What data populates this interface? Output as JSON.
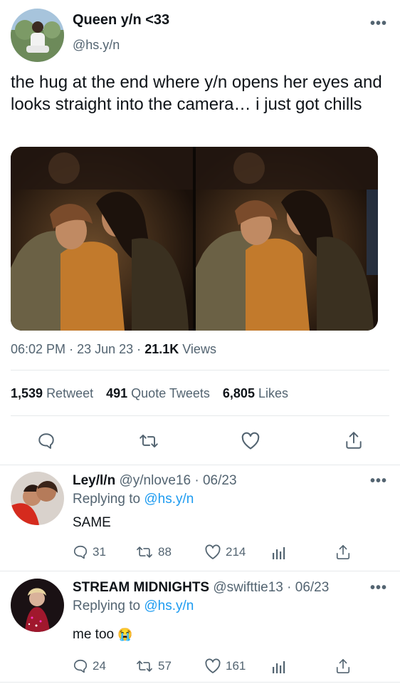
{
  "tweet": {
    "display_name": "Queen y/n <33",
    "handle": "@hs.y/n",
    "text": "the hug at the end where y/n opens her eyes and looks straight into the camera… i just got chills",
    "time": "06:02 PM",
    "sep1": "·",
    "date": "23 Jun 23",
    "sep2": "·",
    "views_count": "21.1K",
    "views_label": "Views",
    "retweets_count": "1,539",
    "retweets_label": "Retweet",
    "quotes_count": "491",
    "quotes_label": "Quote Tweets",
    "likes_count": "6,805",
    "likes_label": "Likes"
  },
  "replies": [
    {
      "display_name": "Ley/l/n",
      "handle_time": "@y/nlove16 · 06/23",
      "replying_prefix": "Replying to",
      "replying_handle": "@hs.y/n",
      "text": "SAME",
      "reply_count": "31",
      "retweet_count": "88",
      "like_count": "214"
    },
    {
      "display_name": "STREAM MIDNIGHTS",
      "handle_time": "@swifttie13 · 06/23",
      "replying_prefix": "Replying to",
      "replying_handle": "@hs.y/n",
      "text": "me too",
      "emoji": "😭",
      "reply_count": "24",
      "retweet_count": "57",
      "like_count": "161"
    }
  ],
  "colors": {
    "accent": "#1d9bf0",
    "text": "#0f1419",
    "secondary": "#536471",
    "divider": "#e6e9eb"
  },
  "icons": [
    "more-icon",
    "reply-icon",
    "retweet-icon",
    "like-icon",
    "share-icon",
    "analytics-icon"
  ]
}
